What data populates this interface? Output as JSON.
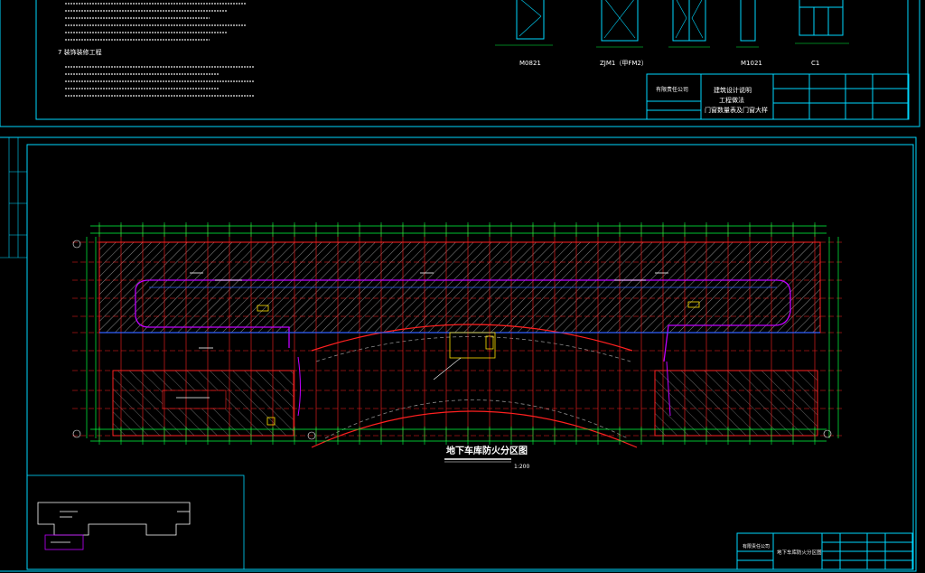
{
  "top_notes": {
    "section_heading": "7  装饰装修工程"
  },
  "door_window_labels": [
    "M0821",
    "ZJM1（甲FM2）",
    "M1021",
    "C1"
  ],
  "title_block_top": {
    "company": "有限责任公司",
    "drawing_title_line1": "建筑设计说明",
    "drawing_title_line2": "工程做法",
    "drawing_title_line3": "门窗数量表及门窗大样"
  },
  "main_drawing": {
    "title": "地下车库防火分区图",
    "scale": "1:200"
  },
  "title_block_bottom": {
    "company": "有限责任公司",
    "drawing_title": "地下车库防火分区图"
  },
  "colors": {
    "frame": "#00d8ff",
    "grid": "#ff2020",
    "dimension": "#00ff40",
    "hatch": "#8a8a8a",
    "fire_zone": "#c000ff",
    "text": "#ffffff"
  }
}
